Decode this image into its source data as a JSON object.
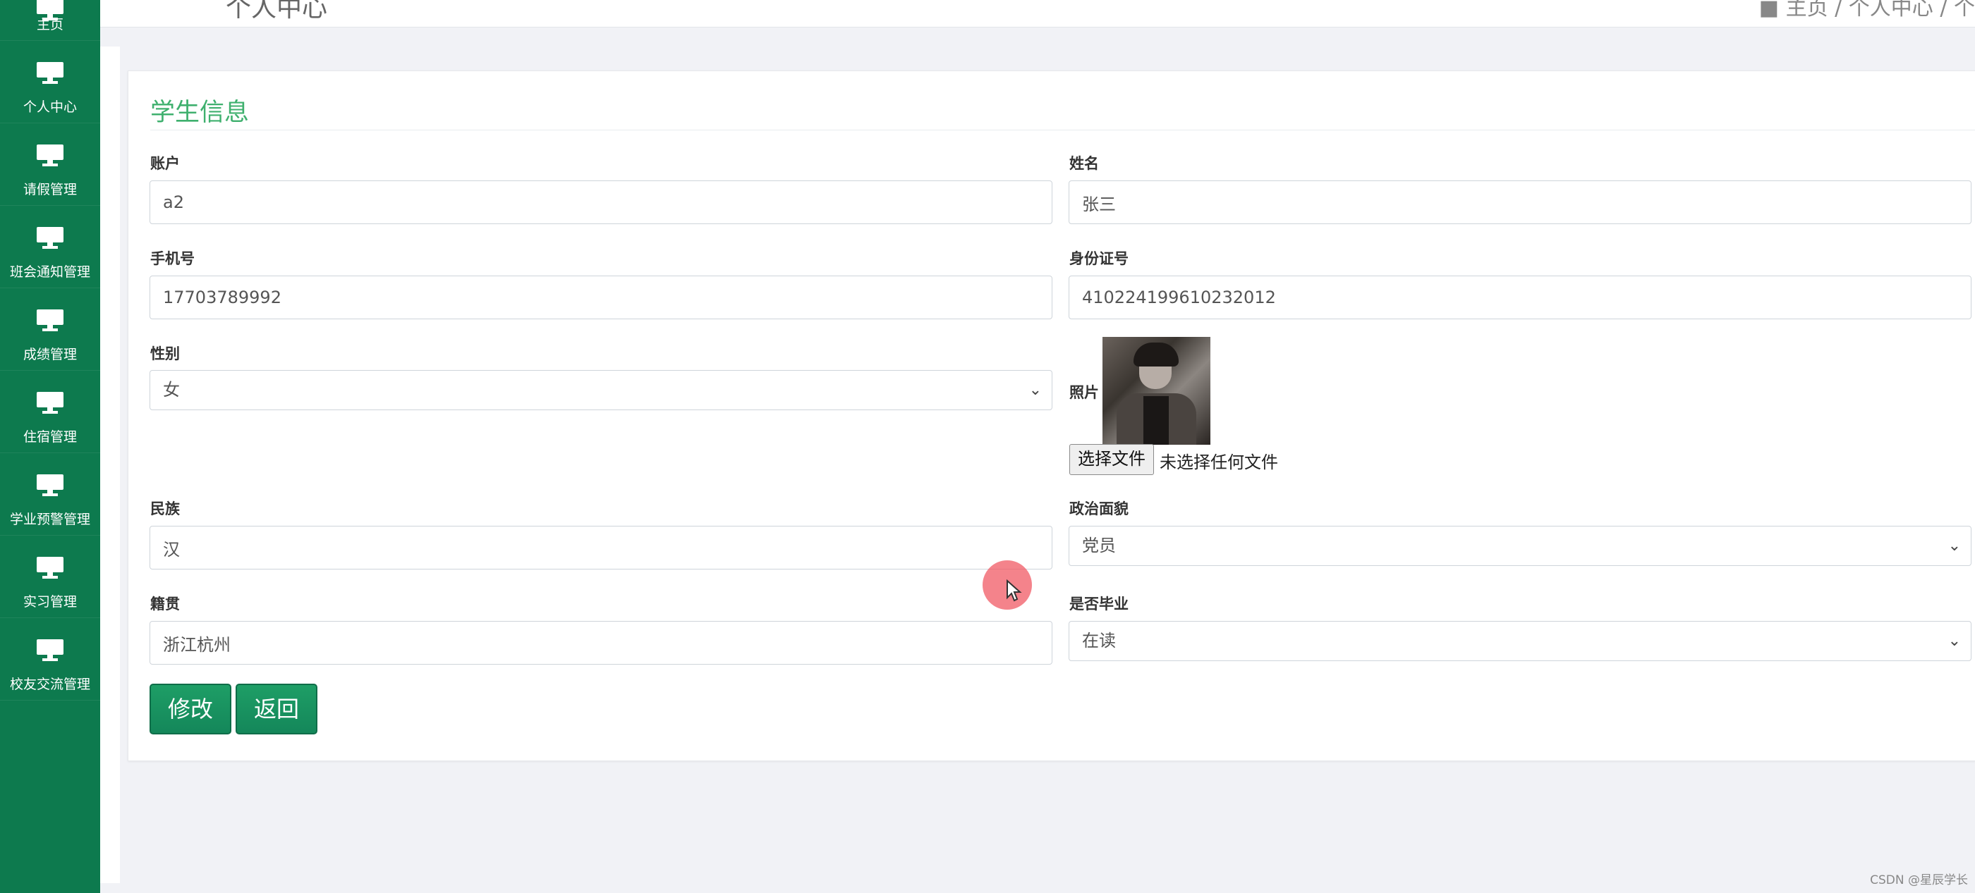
{
  "sidebar": {
    "items": [
      {
        "label": "主页"
      },
      {
        "label": "个人中心"
      },
      {
        "label": "请假管理"
      },
      {
        "label": "班会通知管理"
      },
      {
        "label": "成绩管理"
      },
      {
        "label": "住宿管理"
      },
      {
        "label": "学业预警管理"
      },
      {
        "label": "实习管理"
      },
      {
        "label": "校友交流管理"
      }
    ]
  },
  "header": {
    "title": "个人中心",
    "breadcrumb": "■ 主页 / 个人中心 / 个"
  },
  "form": {
    "title": "学生信息",
    "account": {
      "label": "账户",
      "value": "a2"
    },
    "name": {
      "label": "姓名",
      "value": "张三"
    },
    "phone": {
      "label": "手机号",
      "value": "17703789992"
    },
    "id_card": {
      "label": "身份证号",
      "value": "410224199610232012"
    },
    "gender": {
      "label": "性别",
      "value": "女"
    },
    "photo": {
      "label": "照片",
      "file_button": "选择文件",
      "file_status": "未选择任何文件"
    },
    "ethnicity": {
      "label": "民族",
      "value": "汉"
    },
    "political": {
      "label": "政治面貌",
      "value": "党员"
    },
    "hometown": {
      "label": "籍贯",
      "value": "浙江杭州"
    },
    "graduated": {
      "label": "是否毕业",
      "value": "在读"
    },
    "buttons": {
      "modify": "修改",
      "back": "返回"
    }
  },
  "watermark": "CSDN @星辰学长",
  "colors": {
    "sidebar": "#0d7a4e",
    "title": "#3fb06e",
    "button": "#1e9e66"
  }
}
